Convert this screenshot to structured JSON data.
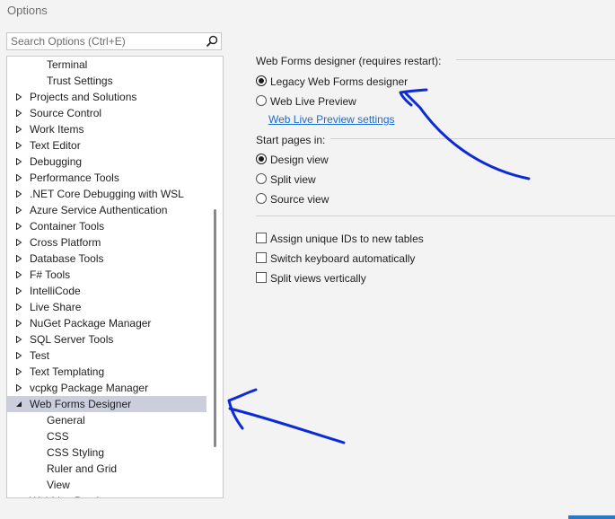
{
  "window": {
    "title": "Options"
  },
  "search": {
    "placeholder": "Search Options (Ctrl+E)",
    "icon": "search-icon"
  },
  "tree": {
    "items": [
      {
        "label": "Terminal",
        "level": 2,
        "arrow": "none"
      },
      {
        "label": "Trust Settings",
        "level": 2,
        "arrow": "none"
      },
      {
        "label": "Projects and Solutions",
        "level": 1,
        "arrow": "collapsed"
      },
      {
        "label": "Source Control",
        "level": 1,
        "arrow": "collapsed"
      },
      {
        "label": "Work Items",
        "level": 1,
        "arrow": "collapsed"
      },
      {
        "label": "Text Editor",
        "level": 1,
        "arrow": "collapsed"
      },
      {
        "label": "Debugging",
        "level": 1,
        "arrow": "collapsed"
      },
      {
        "label": "Performance Tools",
        "level": 1,
        "arrow": "collapsed"
      },
      {
        "label": ".NET Core Debugging with WSL",
        "level": 1,
        "arrow": "collapsed"
      },
      {
        "label": "Azure Service Authentication",
        "level": 1,
        "arrow": "collapsed"
      },
      {
        "label": "Container Tools",
        "level": 1,
        "arrow": "collapsed"
      },
      {
        "label": "Cross Platform",
        "level": 1,
        "arrow": "collapsed"
      },
      {
        "label": "Database Tools",
        "level": 1,
        "arrow": "collapsed"
      },
      {
        "label": "F# Tools",
        "level": 1,
        "arrow": "collapsed"
      },
      {
        "label": "IntelliCode",
        "level": 1,
        "arrow": "collapsed"
      },
      {
        "label": "Live Share",
        "level": 1,
        "arrow": "collapsed"
      },
      {
        "label": "NuGet Package Manager",
        "level": 1,
        "arrow": "collapsed"
      },
      {
        "label": "SQL Server Tools",
        "level": 1,
        "arrow": "collapsed"
      },
      {
        "label": "Test",
        "level": 1,
        "arrow": "collapsed"
      },
      {
        "label": "Text Templating",
        "level": 1,
        "arrow": "collapsed"
      },
      {
        "label": "vcpkg Package Manager",
        "level": 1,
        "arrow": "collapsed"
      },
      {
        "label": "Web Forms Designer",
        "level": 1,
        "arrow": "expanded",
        "selected": true
      },
      {
        "label": "General",
        "level": 2,
        "arrow": "none"
      },
      {
        "label": "CSS",
        "level": 2,
        "arrow": "none"
      },
      {
        "label": "CSS Styling",
        "level": 2,
        "arrow": "none"
      },
      {
        "label": "Ruler and Grid",
        "level": 2,
        "arrow": "none"
      },
      {
        "label": "View",
        "level": 2,
        "arrow": "none"
      },
      {
        "label": "WebLive Preview",
        "level": 1,
        "arrow": "collapsed"
      }
    ]
  },
  "designer": {
    "heading": "Web Forms designer (requires restart):",
    "legacy_label": "Legacy Web Forms designer",
    "legacy_selected": true,
    "live_label": "Web Live Preview",
    "live_selected": false,
    "live_settings_link": "Web Live Preview settings"
  },
  "start_pages": {
    "heading": "Start pages in:",
    "design_label": "Design view",
    "design_selected": true,
    "split_label": "Split view",
    "split_selected": false,
    "source_label": "Source view",
    "source_selected": false
  },
  "checkboxes": {
    "assign_ids_label": "Assign unique IDs to new tables",
    "assign_ids_checked": false,
    "switch_keyboard_label": "Switch keyboard automatically",
    "switch_keyboard_checked": false,
    "split_vertical_label": "Split views vertically",
    "split_vertical_checked": false
  },
  "colors": {
    "accent": "#1a6dd6",
    "selection": "#cccedb",
    "annotation": "#0a2bd6"
  }
}
